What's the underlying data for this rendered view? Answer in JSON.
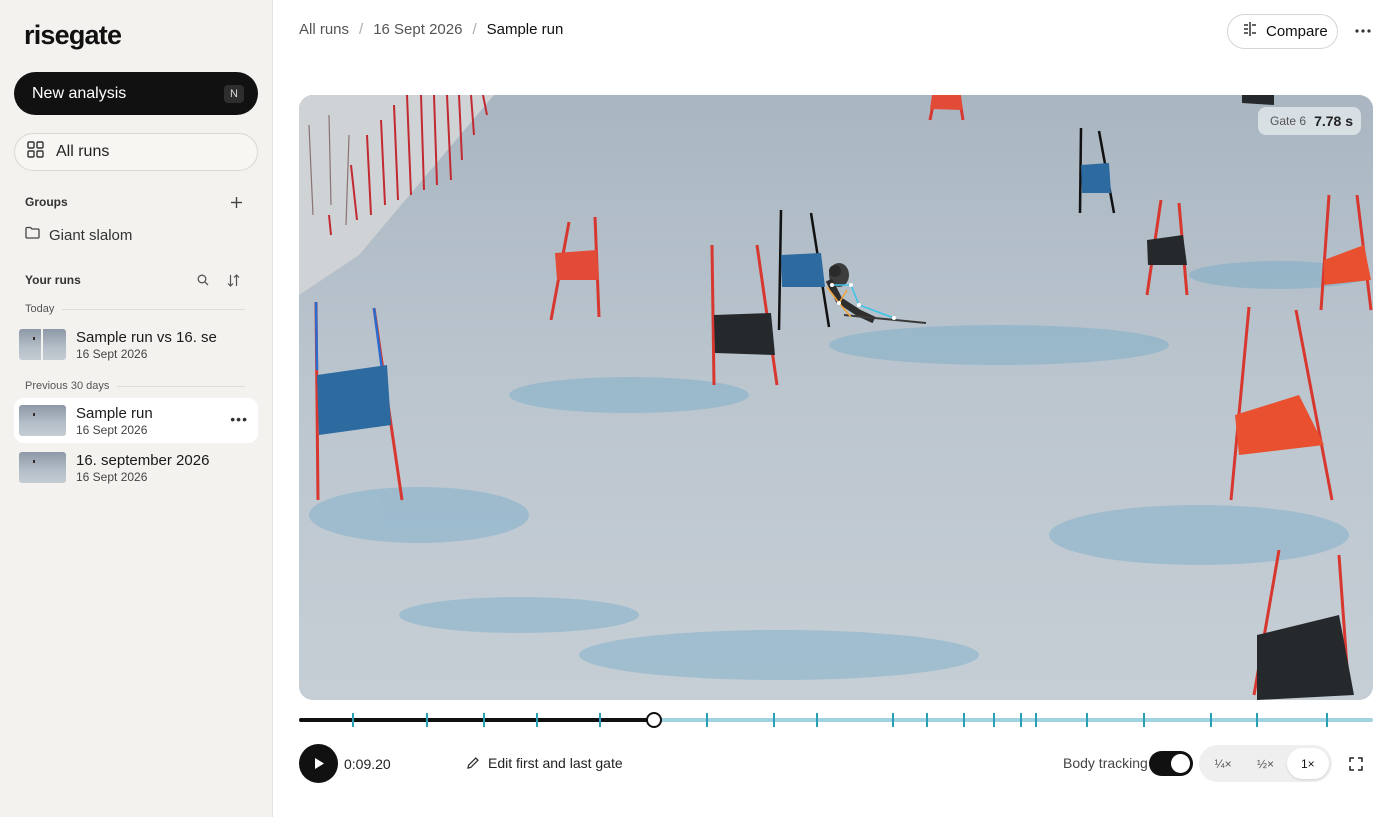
{
  "app": {
    "logo": "risegate"
  },
  "sidebar": {
    "new_analysis": {
      "label": "New analysis",
      "shortcut": "N"
    },
    "all_runs": {
      "label": "All runs"
    },
    "groups": {
      "title": "Groups",
      "items": [
        {
          "label": "Giant slalom"
        }
      ]
    },
    "your_runs": {
      "title": "Your runs",
      "sections": [
        {
          "label": "Today",
          "runs": [
            {
              "title": "Sample run vs 16. se",
              "date": "16 Sept 2026"
            }
          ]
        },
        {
          "label": "Previous 30 days",
          "runs": [
            {
              "title": "Sample run",
              "date": "16 Sept 2026"
            },
            {
              "title": "16. september 2026",
              "date": "16 Sept 2026"
            }
          ]
        }
      ]
    }
  },
  "header": {
    "breadcrumb": [
      "All runs",
      "16 Sept 2026",
      "Sample run"
    ],
    "compare_label": "Compare"
  },
  "video": {
    "gate_label": "Gate 6",
    "gate_time": "7.78 s"
  },
  "timeline": {
    "progress_fraction": 0.331,
    "gate_tick_fractions": [
      0.05,
      0.119,
      0.172,
      0.222,
      0.28,
      0.38,
      0.442,
      0.482,
      0.553,
      0.585,
      0.619,
      0.647,
      0.672,
      0.686,
      0.734,
      0.787,
      0.849,
      0.892,
      0.957
    ]
  },
  "controls": {
    "time": "0:09.20",
    "edit_gate_label": "Edit first and last gate",
    "body_tracking_label": "Body tracking",
    "body_tracking_on": true,
    "speeds": [
      "¼×",
      "½×",
      "1×"
    ],
    "active_speed": "1×"
  },
  "colors": {
    "accent": "#111111",
    "timeline_track": "#9fd4de",
    "timeline_tick": "#2a9fb5"
  }
}
